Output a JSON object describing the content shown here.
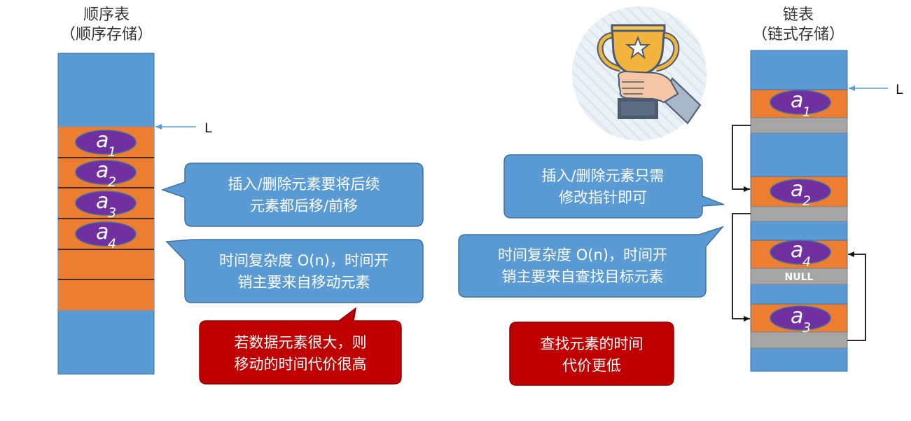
{
  "sequential": {
    "title": "顺序表",
    "subtitle": "（顺序存储）",
    "pointer_label": "L",
    "elements": [
      {
        "letter": "a",
        "sub": "1"
      },
      {
        "letter": "a",
        "sub": "2"
      },
      {
        "letter": "a",
        "sub": "3"
      },
      {
        "letter": "a",
        "sub": "4"
      }
    ]
  },
  "linked": {
    "title": "链表",
    "subtitle": "（链式存储）",
    "pointer_label": "L",
    "null_label": "NULL",
    "nodes": [
      {
        "letter": "a",
        "sub": "1"
      },
      {
        "letter": "a",
        "sub": "2"
      },
      {
        "letter": "a",
        "sub": "4"
      },
      {
        "letter": "a",
        "sub": "3"
      }
    ]
  },
  "bubbles": {
    "seq_insert": [
      "插入/删除元素要将后续",
      "元素都后移/前移"
    ],
    "seq_time": [
      "时间复杂度 O(n)，时间开",
      "销主要来自移动元素"
    ],
    "seq_note": [
      "若数据元素很大，则",
      "移动的时间代价很高"
    ],
    "link_insert": [
      "插入/删除元素只需",
      "修改指针即可"
    ],
    "link_time": [
      "时间复杂度 O(n)，时间开",
      "销主要来自查找目标元素"
    ],
    "link_note": [
      "查找元素的时间",
      "代价更低"
    ]
  },
  "colors": {
    "memory_blue": "#5B9BD5",
    "cell_orange": "#ED7D31",
    "element_purple": "#7030A0",
    "pointer_gray": "#A5A5A5",
    "bubble_blue": "#5B9BD5",
    "bubble_red": "#C00000"
  },
  "icons": {
    "trophy": "trophy-hand-icon"
  }
}
